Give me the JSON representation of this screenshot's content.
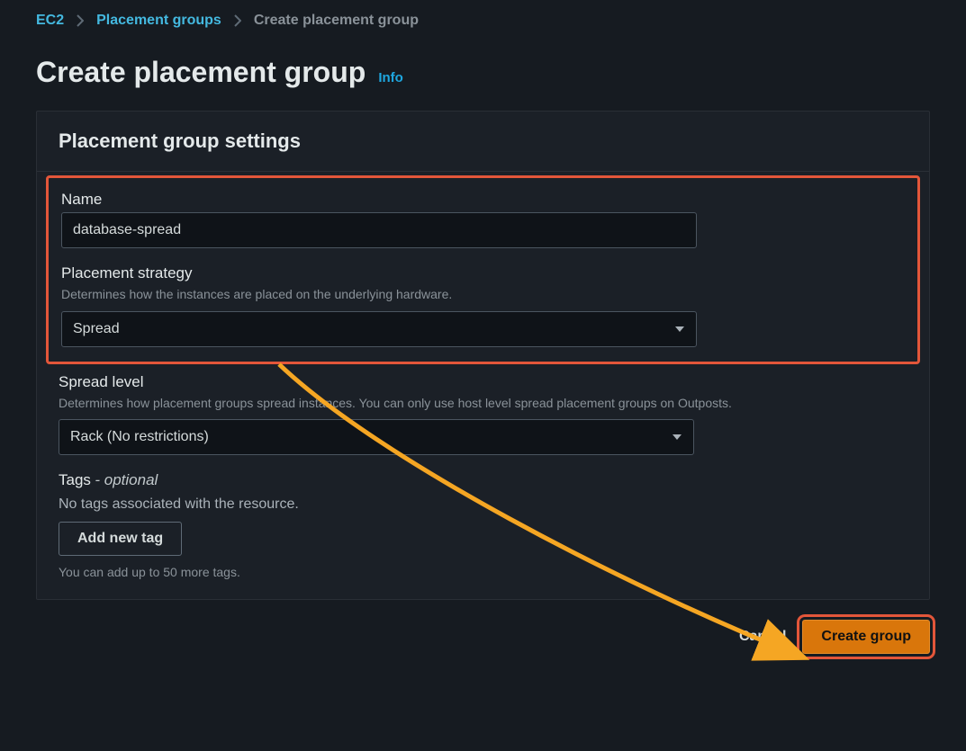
{
  "breadcrumbs": {
    "ec2": "EC2",
    "pg": "Placement groups",
    "current": "Create placement group"
  },
  "title": "Create placement group",
  "info": "Info",
  "panel": {
    "heading": "Placement group settings",
    "name": {
      "label": "Name",
      "value": "database-spread"
    },
    "strategy": {
      "label": "Placement strategy",
      "desc": "Determines how the instances are placed on the underlying hardware.",
      "value": "Spread"
    },
    "spreadlevel": {
      "label": "Spread level",
      "desc": "Determines how placement groups spread instances. You can only use host level spread placement groups on Outposts.",
      "value": "Rack (No restrictions)"
    },
    "tags": {
      "label": "Tags",
      "optional": "- optional",
      "empty": "No tags associated with the resource.",
      "add_btn": "Add new tag",
      "hint": "You can add up to 50 more tags."
    }
  },
  "footer": {
    "cancel": "Cancel",
    "create": "Create group"
  }
}
